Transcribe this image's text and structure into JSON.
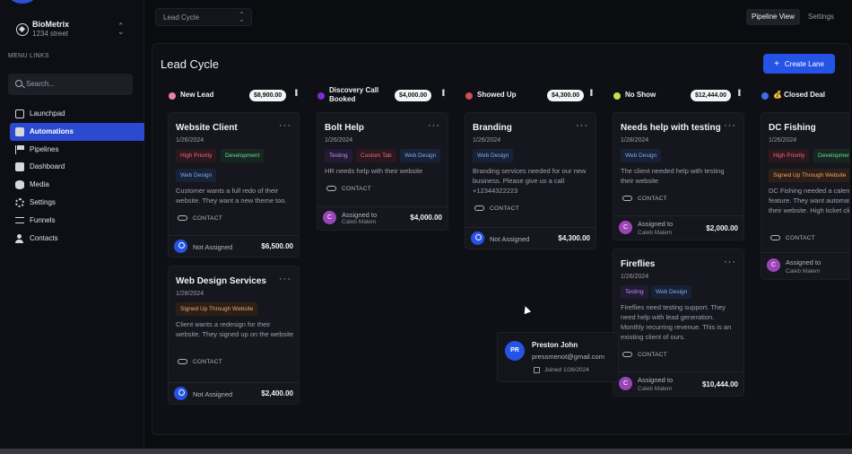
{
  "topbar": {
    "pipeline_select": "Lead Cycle",
    "views": [
      "Pipeline View",
      "Settings"
    ]
  },
  "sidebar": {
    "account_name": "BioMetrix",
    "account_address": "1234 street",
    "menu_heading": "MENU LINKS",
    "search_placeholder": "Search...",
    "items": [
      {
        "label": "Launchpad",
        "icon": "launchpad-icon"
      },
      {
        "label": "Automations",
        "icon": "automations-icon",
        "active": true
      },
      {
        "label": "Pipelines",
        "icon": "flag-icon"
      },
      {
        "label": "Dashboard",
        "icon": "dashboard-icon"
      },
      {
        "label": "Media",
        "icon": "database-icon"
      },
      {
        "label": "Settings",
        "icon": "gear-icon"
      },
      {
        "label": "Funnels",
        "icon": "share-icon"
      },
      {
        "label": "Contacts",
        "icon": "user-icon"
      }
    ]
  },
  "board": {
    "title": "Lead Cycle",
    "create_lane_label": "Create Lane",
    "lanes": [
      {
        "name": "New Lead",
        "total": "$8,900.00",
        "color": "#e77fb3"
      },
      {
        "name": "Discovery Call Booked",
        "total": "$4,000.00",
        "color": "#7b2fd0"
      },
      {
        "name": "Showed Up",
        "total": "$4,300.00",
        "color": "#d24f4f"
      },
      {
        "name": "No Show",
        "total": "$12,444.00",
        "color": "#c9e04a"
      },
      {
        "name": "💰 Closed Deal",
        "total": "",
        "color": "#3f6ee8"
      }
    ],
    "contact_label": "CONTACT",
    "cards": [
      {
        "title": "Website Client",
        "date": "1/26/2024",
        "tags": [
          "High Priority",
          "Development",
          "Web Design"
        ],
        "description": "Customer wants a full redo of their website. They want a new theme too.",
        "assignee": "Not Assigned",
        "amount": "$6,500.00"
      },
      {
        "title": "Web Design Services",
        "date": "1/28/2024",
        "tags": [
          "Signed Up Through Website"
        ],
        "description": "Client wants a redesign for their website. They signed up on the website",
        "assignee": "Not Assigned",
        "amount": "$2,400.00"
      },
      {
        "title": "Bolt Help",
        "date": "1/26/2024",
        "tags": [
          "Testing",
          "Custom Tab",
          "Web Design"
        ],
        "description": "HR needs help with their website",
        "assignee_label": "Assigned to",
        "assignee": "Caleb Malem",
        "avatar": "C",
        "amount": "$4,000.00"
      },
      {
        "title": "Branding",
        "date": "1/26/2024",
        "tags": [
          "Web Design"
        ],
        "description": "Branding services needed for our new business. Please give us a call +12344322223",
        "assignee": "Not Assigned",
        "amount": "$4,300.00"
      },
      {
        "title": "Needs help with testing",
        "date": "1/28/2024",
        "tags": [
          "Web Design"
        ],
        "description": "The client needed help with testing their website",
        "assignee_label": "Assigned to",
        "assignee": "Caleb Malem",
        "avatar": "C",
        "amount": "$2,000.00"
      },
      {
        "title": "Fireflies",
        "date": "1/26/2024",
        "tags": [
          "Testing",
          "Web Design"
        ],
        "description": "Fireflies need testing support. They need help with lead generation. Monthly recurring revenue. This is an existing client of ours.",
        "assignee_label": "Assigned to",
        "assignee": "Caleb Malem",
        "avatar": "C",
        "amount": "$10,444.00"
      },
      {
        "title": "DC Fishing",
        "date": "1/26/2024",
        "tags": [
          "High Priority",
          "Development",
          "Signed Up Through Website"
        ],
        "description": "DC Fishing needed a calendar booking feature. They want automations built into their website. High ticket client.",
        "assignee_label": "Assigned to",
        "assignee": "Caleb Malem",
        "avatar": "C",
        "amount": ""
      }
    ],
    "drag_contact": {
      "initials": "PR",
      "name": "Preston John",
      "email": "pressmenot@gmail.com",
      "joined": "Joined 1/26/2024"
    }
  }
}
